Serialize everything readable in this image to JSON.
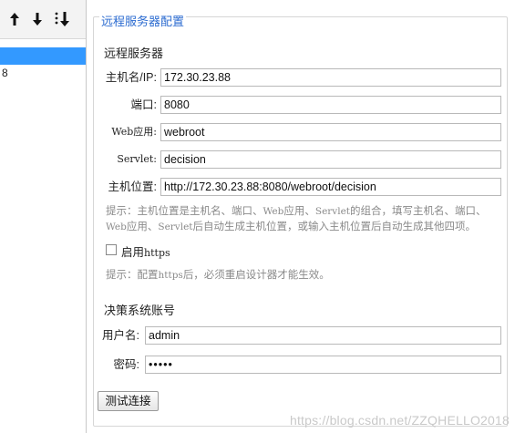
{
  "left_panel": {
    "items": [
      "",
      "8"
    ]
  },
  "panel": {
    "title": "远程服务器配置",
    "server_section_title": "远程服务器",
    "fields": {
      "host_label": "主机名/IP:",
      "host_value": "172.30.23.88",
      "port_label": "端口:",
      "port_value": "8080",
      "webapp_label": "Web应用:",
      "webapp_value": "webroot",
      "servlet_label": "Servlet:",
      "servlet_value": "decision",
      "hostloc_label": "主机位置:",
      "hostloc_value": "http://172.30.23.88:8080/webroot/decision"
    },
    "hint1_line1_a": "提示：主机位置是主机名、端口、",
    "hint1_line1_b": "Web",
    "hint1_line1_c": "应用、",
    "hint1_line1_d": "Servlet",
    "hint1_line1_e": "的组合，填写主机名、端口、",
    "hint1_line2_a": "Web",
    "hint1_line2_b": "应用、",
    "hint1_line2_c": "Servlet",
    "hint1_line2_d": "后自动生成主机位置，或输入主机位置后自动生成其他四项。",
    "https_label_a": "启用",
    "https_label_b": "https",
    "https_checked": false,
    "hint2_a": "提示：配置",
    "hint2_b": "https",
    "hint2_c": "后，必须重启设计器才能生效。",
    "account_section_title": "决策系统账号",
    "username_label": "用户名:",
    "username_value": "admin",
    "password_label": "密码:",
    "password_value": "•••••",
    "test_button": "测试连接"
  },
  "watermark": "https://blog.csdn.net/ZZQHELLO2018",
  "icons": [
    "arrow-up-icon",
    "arrow-down-icon",
    "sort-icon",
    "collapse-left-icon"
  ]
}
